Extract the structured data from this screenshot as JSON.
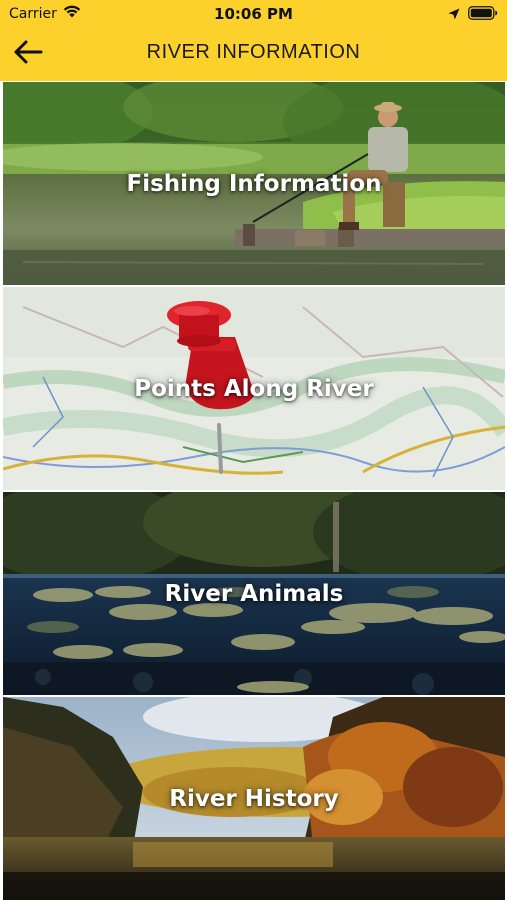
{
  "status_bar": {
    "carrier": "Carrier",
    "time": "10:06 PM",
    "icons": [
      "wifi-icon",
      "location-arrow-icon",
      "battery-icon"
    ]
  },
  "nav": {
    "title": "RIVER INFORMATION",
    "back_icon": "arrow-left-icon"
  },
  "menu": {
    "items": [
      {
        "label": "Fishing Information",
        "image": "angler-on-riverbank"
      },
      {
        "label": "Points Along River",
        "image": "red-pushpin-on-map"
      },
      {
        "label": "River Animals",
        "image": "fish-underwater"
      },
      {
        "label": "River History",
        "image": "autumn-river-landscape"
      }
    ]
  },
  "colors": {
    "header": "#fdd12b",
    "label": "#ffffff"
  }
}
